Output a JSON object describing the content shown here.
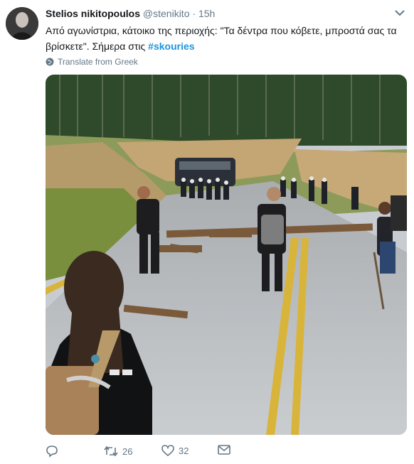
{
  "tweet": {
    "author_name": "Stelios nikitopoulos",
    "handle": "@stenikito",
    "separator": "·",
    "time": "15h",
    "text_main": "Από αγωνίστρια, κάτοικο της περιοχής: \"Τα δέντρα που κόβετε, μπροστά σας τα βρίσκετε\". Σήμερα στις ",
    "hashtag": "#skouries",
    "translate_label": "Translate from Greek"
  },
  "actions": {
    "reply_count": "",
    "retweet_count": "26",
    "like_count": "32"
  },
  "icons": {
    "reply": "reply-icon",
    "retweet": "retweet-icon",
    "like": "heart-icon",
    "dm": "envelope-icon",
    "translate": "globe-icon",
    "menu": "chevron-down-icon"
  },
  "colors": {
    "link": "#1b95e0",
    "secondary": "#657786",
    "text": "#14171a"
  }
}
